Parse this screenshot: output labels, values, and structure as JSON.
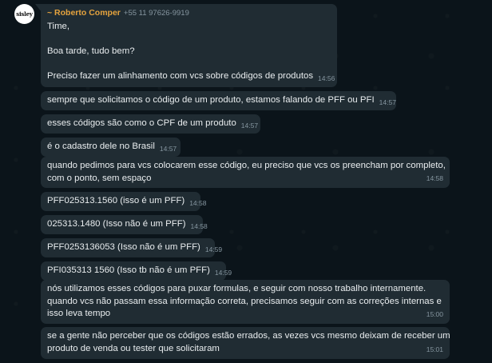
{
  "sender": {
    "name": "~ Roberto Comper",
    "phone": "+55 11 97626-9919",
    "avatar_text": "sisley"
  },
  "messages": [
    {
      "lines": [
        "Time,",
        "",
        "Boa tarde, tudo bem?",
        "",
        "Preciso fazer um alinhamento com vcs sobre códigos de produtos"
      ],
      "time": "14:56"
    },
    {
      "lines": [
        "sempre que solicitamos o código de um produto, estamos falando de PFF ou PFI"
      ],
      "time": "14:57"
    },
    {
      "lines": [
        "esses códigos são como o CPF de um produto"
      ],
      "time": "14:57"
    },
    {
      "lines": [
        "é o cadastro dele no Brasil"
      ],
      "time": "14:57"
    },
    {
      "lines": [
        "quando pedimos para vcs colocarem esse código, eu preciso que vcs os preencham por completo,",
        "com o ponto, sem espaço"
      ],
      "time": "14:58"
    },
    {
      "lines": [
        "PFF025313.1560 (isso é um PFF)"
      ],
      "time": "14:58"
    },
    {
      "lines": [
        "025313.1480 (Isso não é um PFF)"
      ],
      "time": "14:58"
    },
    {
      "lines": [
        "PFF0253136053 (Isso não é um PFF)"
      ],
      "time": "14:59"
    },
    {
      "lines": [
        "PFI035313 1560 (Isso tb não é um PFF)"
      ],
      "time": "14:59"
    },
    {
      "lines": [
        "nós utilizamos esses códigos para puxar formulas, e seguir com nosso trabalho internamente.",
        "quando vcs não passam essa informação correta, precisamos seguir com as correções internas e",
        "isso leva tempo"
      ],
      "time": "15:00"
    },
    {
      "lines": [
        "se a gente não perceber que os códigos estão errados, as vezes vcs mesmo deixam de receber um",
        "produto de venda ou tester que solicitaram"
      ],
      "time": "15:01"
    }
  ]
}
